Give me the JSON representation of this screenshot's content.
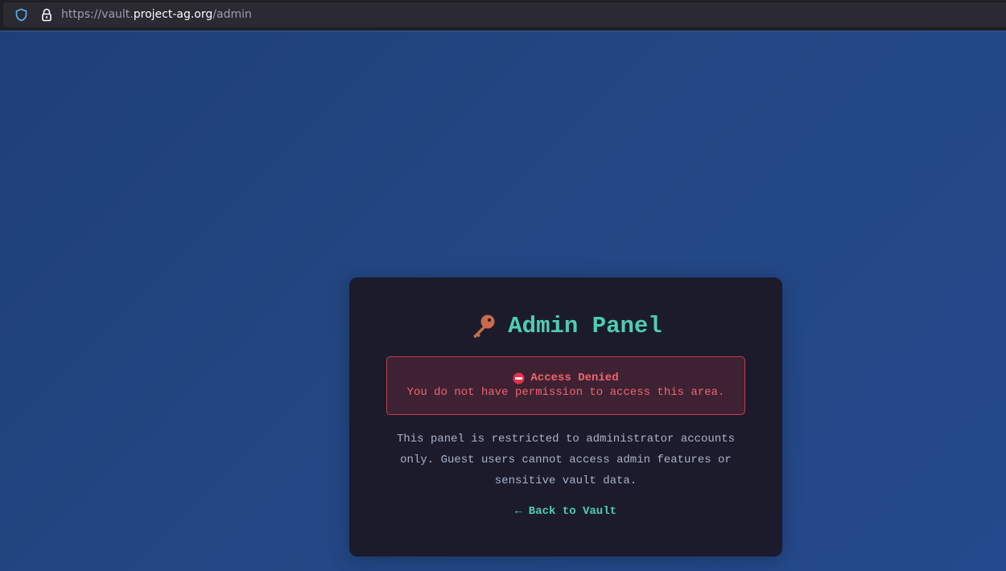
{
  "browser": {
    "url_scheme": "https://vault.",
    "url_host": "project-ag.org",
    "url_path": "/admin"
  },
  "card": {
    "title": "Admin Panel",
    "title_icon": "key-icon",
    "alert": {
      "icon": "no-entry-icon",
      "title": "Access Denied",
      "message": "You do not have permission to access this area."
    },
    "description": "This panel is restricted to administrator accounts only. Guest users cannot access admin features or sensitive vault data.",
    "back_link": {
      "arrow": "←",
      "label": "Back to Vault"
    }
  },
  "colors": {
    "accent": "#4ecdb1",
    "danger": "#f0646e",
    "card_bg": "#1b1b2c",
    "page_bg": "#234783"
  }
}
